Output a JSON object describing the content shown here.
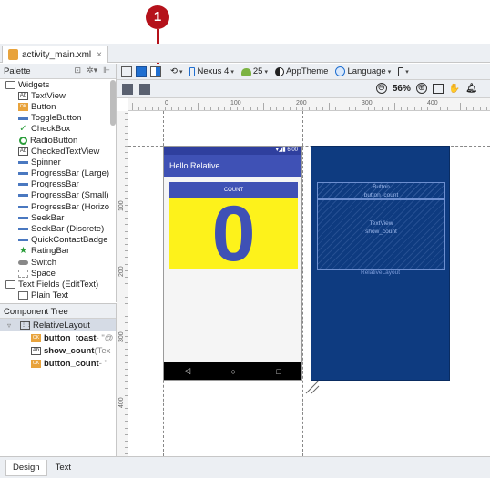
{
  "callout": {
    "number": "1"
  },
  "editor_tab": {
    "filename": "activity_main.xml",
    "close": "×"
  },
  "palette": {
    "title": "Palette",
    "items": [
      {
        "label": "Widgets",
        "icon": "folder-icon",
        "indent": 0
      },
      {
        "label": "TextView",
        "icon": "textview-icon",
        "indent": 1
      },
      {
        "label": "Button",
        "icon": "button-icon",
        "indent": 1
      },
      {
        "label": "ToggleButton",
        "icon": "togglebutton-icon",
        "indent": 1
      },
      {
        "label": "CheckBox",
        "icon": "checkbox-icon",
        "indent": 1
      },
      {
        "label": "RadioButton",
        "icon": "radiobutton-icon",
        "indent": 1
      },
      {
        "label": "CheckedTextView",
        "icon": "checkedtextview-icon",
        "indent": 1
      },
      {
        "label": "Spinner",
        "icon": "spinner-icon",
        "indent": 1
      },
      {
        "label": "ProgressBar (Large)",
        "icon": "progressbar-icon",
        "indent": 1
      },
      {
        "label": "ProgressBar",
        "icon": "progressbar-icon",
        "indent": 1
      },
      {
        "label": "ProgressBar (Small)",
        "icon": "progressbar-icon",
        "indent": 1
      },
      {
        "label": "ProgressBar (Horizo",
        "icon": "progressbar-icon",
        "indent": 1
      },
      {
        "label": "SeekBar",
        "icon": "seekbar-icon",
        "indent": 1
      },
      {
        "label": "SeekBar (Discrete)",
        "icon": "seekbar-icon",
        "indent": 1
      },
      {
        "label": "QuickContactBadge",
        "icon": "contact-icon",
        "indent": 1
      },
      {
        "label": "RatingBar",
        "icon": "star-icon",
        "indent": 1
      },
      {
        "label": "Switch",
        "icon": "switch-icon",
        "indent": 1
      },
      {
        "label": "Space",
        "icon": "space-icon",
        "indent": 1
      },
      {
        "label": "Text Fields (EditText)",
        "icon": "folder-icon",
        "indent": 0
      },
      {
        "label": "Plain Text",
        "icon": "edittext-icon",
        "indent": 1
      }
    ]
  },
  "component_tree": {
    "title": "Component Tree",
    "rows": [
      {
        "id": "RelativeLayout",
        "suffix": "",
        "icon": "relativelayout-icon",
        "indent": 1,
        "selected": true
      },
      {
        "id": "button_toast",
        "suffix": " - \"@",
        "icon": "button-icon",
        "indent": 2,
        "selected": false
      },
      {
        "id": "show_count",
        "suffix": " (Tex",
        "icon": "textview-icon",
        "indent": 2,
        "selected": false
      },
      {
        "id": "button_count",
        "suffix": " - \"",
        "icon": "button-icon",
        "indent": 2,
        "selected": false
      }
    ]
  },
  "toolbar": {
    "device": "Nexus 4",
    "api": "25",
    "theme": "AppTheme",
    "language": "Language"
  },
  "zoom": {
    "level": "56%",
    "minus": "⊖",
    "plus": "⊕"
  },
  "ruler": {
    "top_labels": [
      "0",
      "100",
      "200",
      "300",
      "400"
    ],
    "left_labels": [
      "100",
      "200",
      "300",
      "400"
    ]
  },
  "design": {
    "status_time": "6:00",
    "app_title": "Hello Relative",
    "count_button": "COUNT",
    "count_value": "0",
    "nav_back": "◁",
    "nav_home": "○",
    "nav_recent": "□"
  },
  "blueprint": {
    "button_line1": "Button",
    "button_line2": "button_count",
    "text_line1": "TextView",
    "text_line2": "show_count",
    "layout_label": "RelativeLayout"
  },
  "bottom_tabs": [
    {
      "label": "Design",
      "active": true
    },
    {
      "label": "Text",
      "active": false
    }
  ],
  "colors": {
    "callout": "#b5121b",
    "app_bar": "#3f51b5",
    "count_bg": "#fdf21b",
    "blueprint_bg": "#0e3b80"
  }
}
